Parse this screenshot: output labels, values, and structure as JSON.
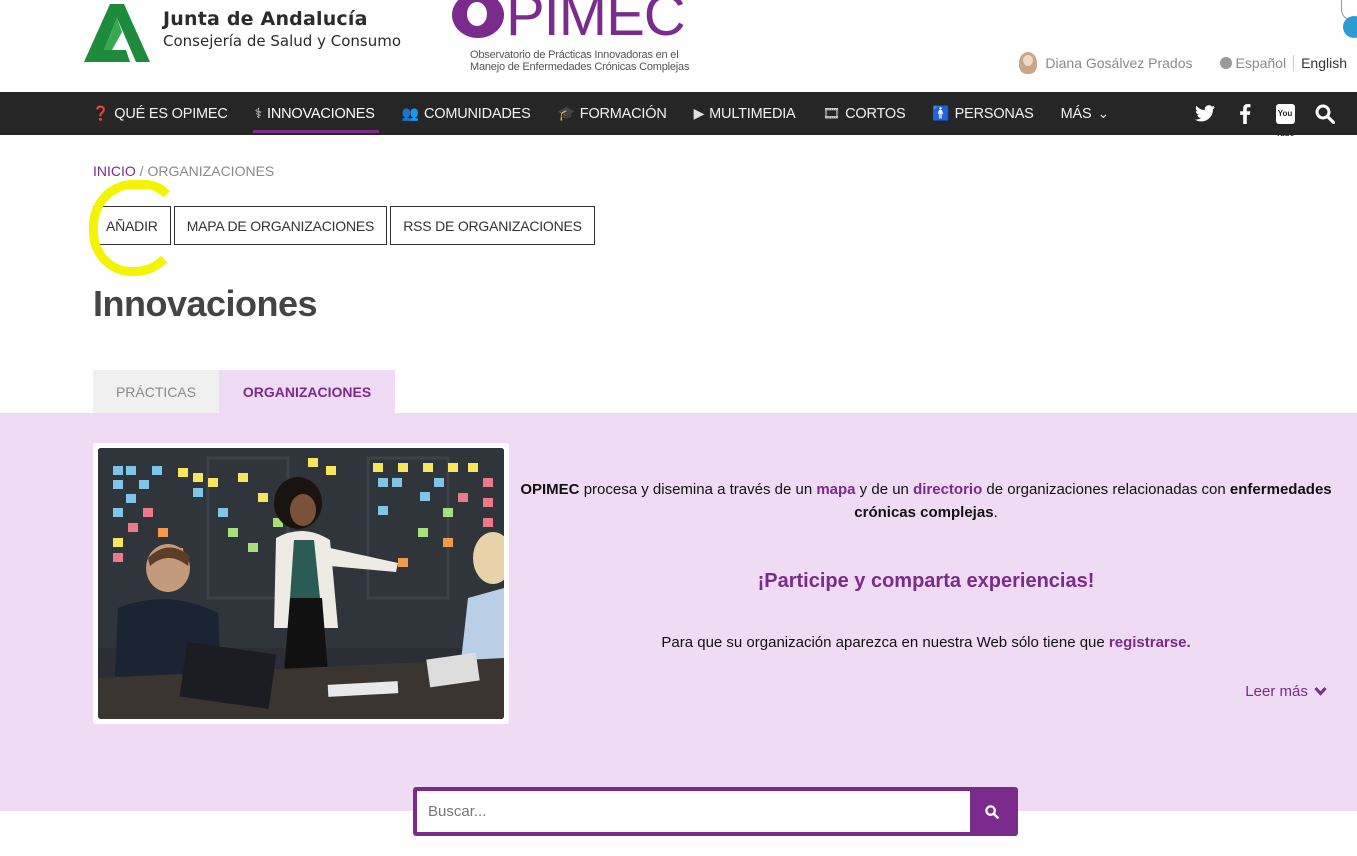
{
  "header": {
    "junta_title": "Junta de Andalucía",
    "junta_subtitle": "Consejería de Salud y Consumo",
    "opimec_word": "PIMEC",
    "opimec_tagline_1": "Observatorio de Prácticas Innovadoras en el",
    "opimec_tagline_2": "Manejo de Enfermedades Crónicas Complejas",
    "user_name": "Diana Gosálvez Prados",
    "lang_es": "Español",
    "lang_en": "English"
  },
  "nav": {
    "items": [
      {
        "label": "QUÉ ES OPIMEC",
        "icon": "question-circle-icon",
        "glyph": "❓"
      },
      {
        "label": "INNOVACIONES",
        "icon": "stethoscope-icon",
        "glyph": "⚕"
      },
      {
        "label": "COMUNIDADES",
        "icon": "users-icon",
        "glyph": "👥"
      },
      {
        "label": "FORMACIÓN",
        "icon": "graduation-cap-icon",
        "glyph": "🎓"
      },
      {
        "label": "MULTIMEDIA",
        "icon": "play-icon",
        "glyph": "▶"
      },
      {
        "label": "CORTOS",
        "icon": "film-icon",
        "glyph": "🎞"
      },
      {
        "label": "PERSONAS",
        "icon": "person-icon",
        "glyph": "🚹"
      },
      {
        "label": "MÁS",
        "icon": "chevron-down-icon",
        "glyph": "⌄"
      }
    ],
    "social": {
      "twitter": "twitter-icon",
      "facebook": "facebook-icon",
      "youtube": "youtube-icon",
      "search": "search-icon",
      "youtube_text": "You Tube"
    }
  },
  "breadcrumb": {
    "home": "INICIO",
    "separator": "/",
    "current": "ORGANIZACIONES"
  },
  "actions": {
    "add": "AÑADIR",
    "map": "MAPA DE ORGANIZACIONES",
    "rss": "RSS DE ORGANIZACIONES"
  },
  "page": {
    "title": "Innovaciones"
  },
  "tabs": {
    "practices": "PRÁCTICAS",
    "organizations": "ORGANIZACIONES"
  },
  "panel": {
    "intro_brand": "OPIMEC",
    "intro_1": " procesa y disemina a través de un ",
    "intro_map": "mapa",
    "intro_2": " y de un ",
    "intro_directory": "directorio",
    "intro_3": " de organizaciones relacionadas con ",
    "intro_bold": "enfermedades crónicas complejas",
    "intro_end": ".",
    "cta": "¡Participe y comparta experiencias!",
    "note": "Para que su organización aparezca en nuestra Web sólo tiene que ",
    "note_link": "registrarse.",
    "readmore": "Leer más"
  },
  "search": {
    "placeholder": "Buscar..."
  },
  "colors": {
    "brand_purple": "#7a2b8c",
    "panel_bg": "#efdbf3",
    "nav_bg": "#262626",
    "highlight": "#f4f400"
  }
}
